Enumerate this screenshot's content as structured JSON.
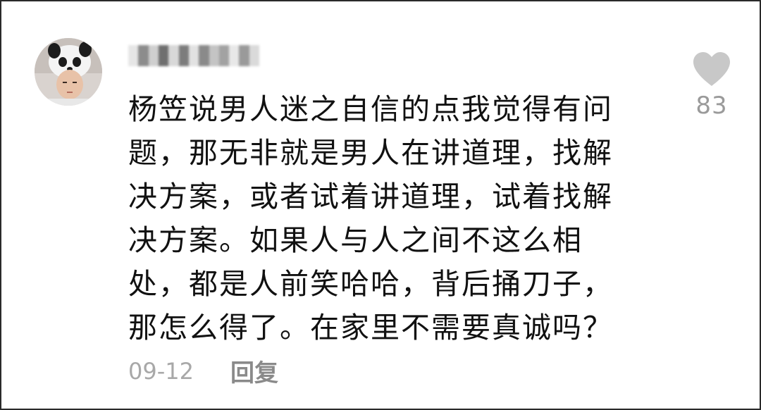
{
  "comment": {
    "username": "",
    "lines": [
      "杨笠说男人迷之自信的点我觉得有问",
      "题，那无非就是男人在讲道理，找解",
      "决方案，或者试着讲道理，试着找解",
      "决方案。如果人与人之间不这么相",
      "处，都是人前笑哈哈，背后捅刀子，",
      "那怎么得了。在家里不需要真诚吗？"
    ],
    "date": "09-12",
    "reply_label": "回复",
    "like_count": "83"
  },
  "icons": {
    "like": "heart-icon",
    "avatar": "user-avatar"
  },
  "colors": {
    "text": "#111111",
    "muted": "#9a9a9a",
    "heart": "#c8c8c8"
  }
}
